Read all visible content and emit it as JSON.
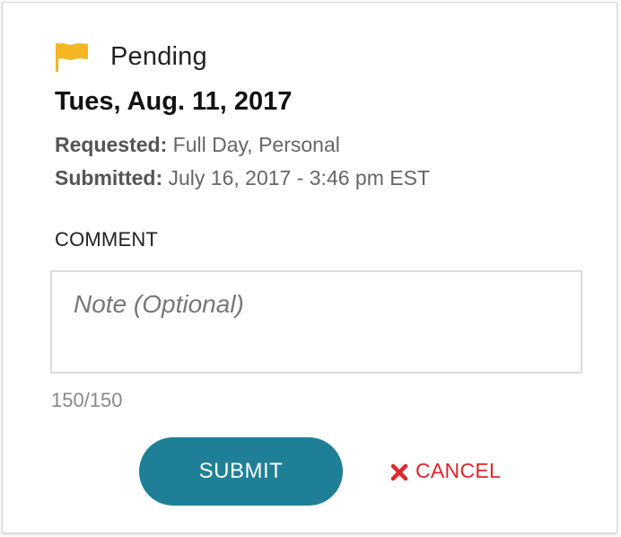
{
  "status": {
    "label": "Pending",
    "icon": "flag-icon",
    "icon_color": "#f6b622"
  },
  "request": {
    "date_title": "Tues, Aug. 11, 2017",
    "requested_label": "Requested:",
    "requested_value": "Full Day, Personal",
    "submitted_label": "Submitted:",
    "submitted_value": "July 16, 2017 - 3:46 pm EST"
  },
  "comment": {
    "heading": "COMMENT",
    "placeholder": "Note (Optional)",
    "value": "",
    "char_count": "150/150"
  },
  "actions": {
    "submit_label": "SUBMIT",
    "submit_color": "#1f7f96",
    "cancel_label": "CANCEL",
    "cancel_icon": "close-icon",
    "cancel_color": "#e0262d"
  }
}
